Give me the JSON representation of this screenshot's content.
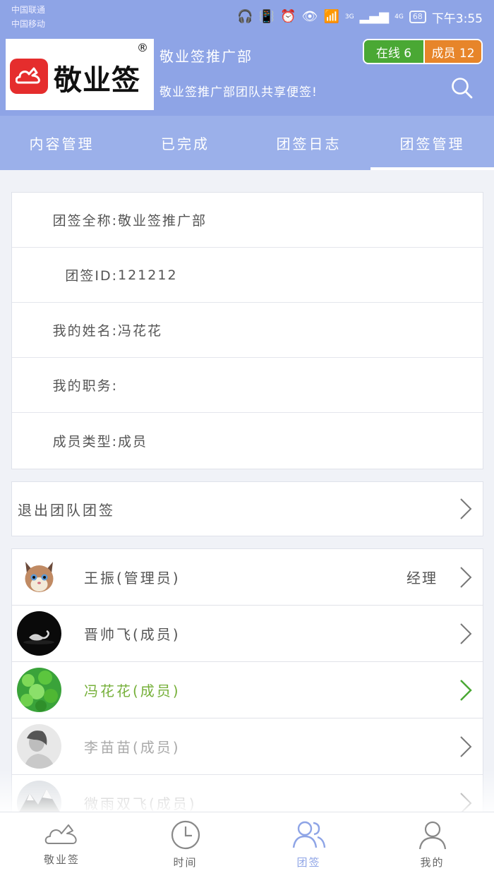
{
  "status_bar": {
    "carrier_1": "中国联通",
    "carrier_2": "中国移动",
    "signal_3g": "3G",
    "signal_4g": "4G",
    "battery": "68",
    "time": "下午3:55"
  },
  "header": {
    "logo_text": "敬业签",
    "logo_registered": "®",
    "team_name": "敬业签推广部",
    "team_description": "敬业签推广部团队共享便签!",
    "online_label": "在线 6",
    "members_label": "成员 12"
  },
  "tabs": [
    {
      "label": "内容管理",
      "active": false
    },
    {
      "label": "已完成",
      "active": false
    },
    {
      "label": "团签日志",
      "active": false
    },
    {
      "label": "团签管理",
      "active": true
    }
  ],
  "info": {
    "full_name_label": "团签全称:",
    "full_name_value": "敬业签推广部",
    "id_label": "团签ID:",
    "id_value": "121212",
    "my_name_label": "我的姓名:",
    "my_name_value": "冯花花",
    "my_position_label": "我的职务:",
    "my_position_value": "",
    "member_type_label": "成员类型:",
    "member_type_value": "成员"
  },
  "exit": {
    "label": "退出团队团签"
  },
  "members": [
    {
      "name": "王振(管理员)",
      "role": "经理",
      "avatar": "cat-avatar",
      "style": "normal"
    },
    {
      "name": "晋帅飞(成员)",
      "role": "",
      "avatar": "swan-avatar",
      "style": "normal"
    },
    {
      "name": "冯花花(成员)",
      "role": "",
      "avatar": "clover-avatar",
      "style": "self"
    },
    {
      "name": "李苗苗(成员)",
      "role": "",
      "avatar": "portrait-avatar",
      "style": "dim"
    },
    {
      "name": "微雨双飞(成员)",
      "role": "",
      "avatar": "mountain-avatar",
      "style": "dim"
    }
  ],
  "bottom_nav": [
    {
      "label": "敬业签",
      "icon": "cloud-note-icon",
      "active": false
    },
    {
      "label": "时间",
      "icon": "clock-icon",
      "active": false
    },
    {
      "label": "团签",
      "icon": "team-icon",
      "active": true
    },
    {
      "label": "我的",
      "icon": "user-icon",
      "active": false
    }
  ],
  "colors": {
    "header_bg": "#8ea4e6",
    "tab_bg": "#9bb0ea",
    "online_badge": "#4aa834",
    "members_badge": "#e7852a",
    "self_highlight": "#76b03a",
    "logo_red": "#e52d2d"
  }
}
